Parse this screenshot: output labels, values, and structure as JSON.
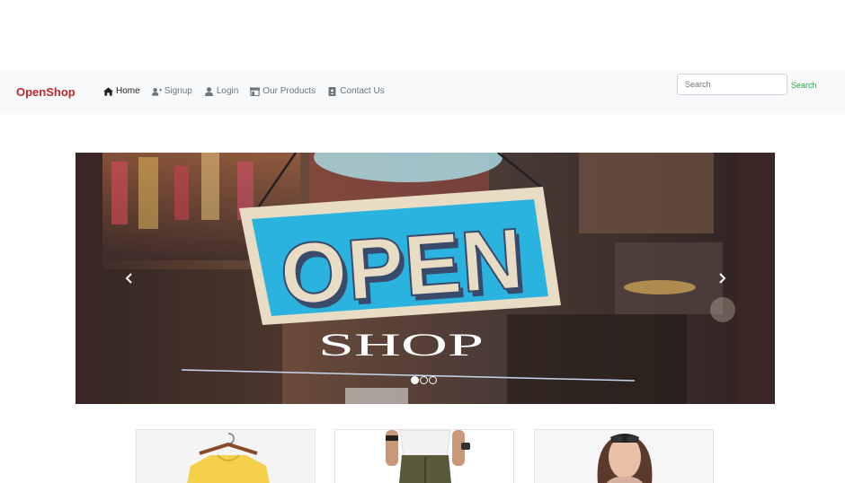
{
  "navbar": {
    "brand": "OpenShop",
    "items": [
      {
        "label": "Home",
        "icon": "home-icon",
        "active": true
      },
      {
        "label": "Signup",
        "icon": "user-plus-icon",
        "active": false
      },
      {
        "label": "Login",
        "icon": "user-icon",
        "active": false
      },
      {
        "label": "Our Products",
        "icon": "store-icon",
        "active": false
      },
      {
        "label": "Contact Us",
        "icon": "contact-card-icon",
        "active": false
      }
    ],
    "search_placeholder": "Search",
    "search_button": "Search"
  },
  "carousel": {
    "sign_text": "OPEN",
    "sub_text": "SHOP",
    "slide_count": 3,
    "active_slide": 1
  },
  "products": [
    {
      "image": "yellow-shirt-on-hanger"
    },
    {
      "image": "man-in-white-tshirt-and-cargo-pants"
    },
    {
      "image": "woman-with-sunglasses"
    }
  ],
  "colors": {
    "brand": "#c1272d",
    "navbar_bg": "#f8f9fa",
    "search_button": "#28a745",
    "sign_blue": "#2bb3e0"
  }
}
